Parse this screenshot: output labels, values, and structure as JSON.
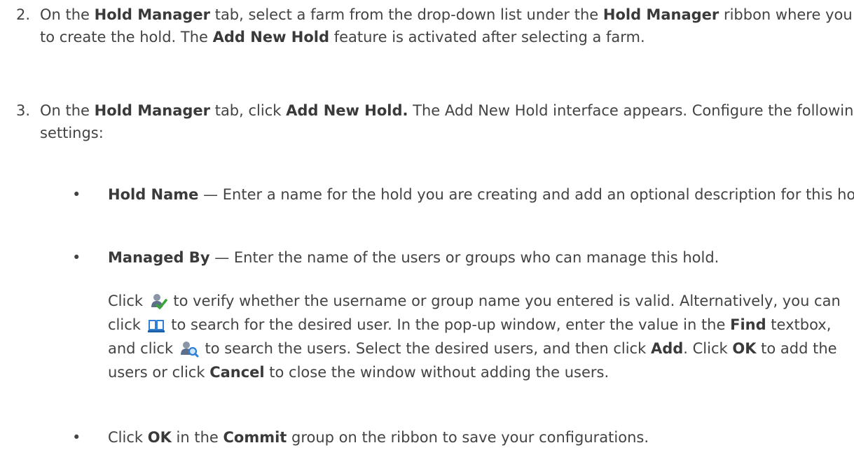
{
  "step2": {
    "number": "2.",
    "t1": "On the ",
    "b1": "Hold Manager",
    "t2": " tab, select a farm from the drop-down list under the ",
    "b2": "Hold Manager",
    "t3": " ribbon where you want to create the hold. The ",
    "b3": "Add New Hold",
    "t4": " feature is activated after selecting a farm."
  },
  "step3": {
    "number": "3.",
    "t1": "On the ",
    "b1": "Hold Manager",
    "t2": " tab, click ",
    "b2": "Add New Hold.",
    "t3": " The Add New Hold interface appears. Configure the following settings:"
  },
  "bullets": {
    "hold_name": {
      "dot": "•",
      "term": "Hold Name",
      "text": " — Enter a name for the hold you are creating and add an optional description for this hold."
    },
    "managed_by": {
      "dot": "•",
      "term": "Managed By",
      "text": " — Enter the name of the users or groups who can manage this hold."
    },
    "commit": {
      "dot": "•",
      "t1": "Click ",
      "b1": "OK",
      "t2": " in the ",
      "b2": "Commit",
      "t3": " group on the ribbon to save your configurations."
    }
  },
  "managed_by_detail": {
    "t1": "Click ",
    "t2": " to verify whether the username or group name you entered is valid. Alternatively, you can click ",
    "t3": " to search for the desired user. In the pop-up window, enter the value in the ",
    "b1": "Find",
    "t4": " textbox, and click ",
    "t5": " to search the users. Select the desired users, and then click ",
    "b2": "Add",
    "t6": ". Click ",
    "b3": "OK",
    "t7": " to add the users or click ",
    "b4": "Cancel",
    "t8": " to close the window without adding the users."
  },
  "icons": {
    "check_names": "user-check-icon",
    "address_book": "address-book-icon",
    "search_users": "user-search-icon"
  },
  "colors": {
    "text": "#434343",
    "bold_text": "#3a3a3a",
    "background": "#ffffff",
    "icon_blue": "#2f7fd6",
    "icon_green": "#3aa33a"
  }
}
